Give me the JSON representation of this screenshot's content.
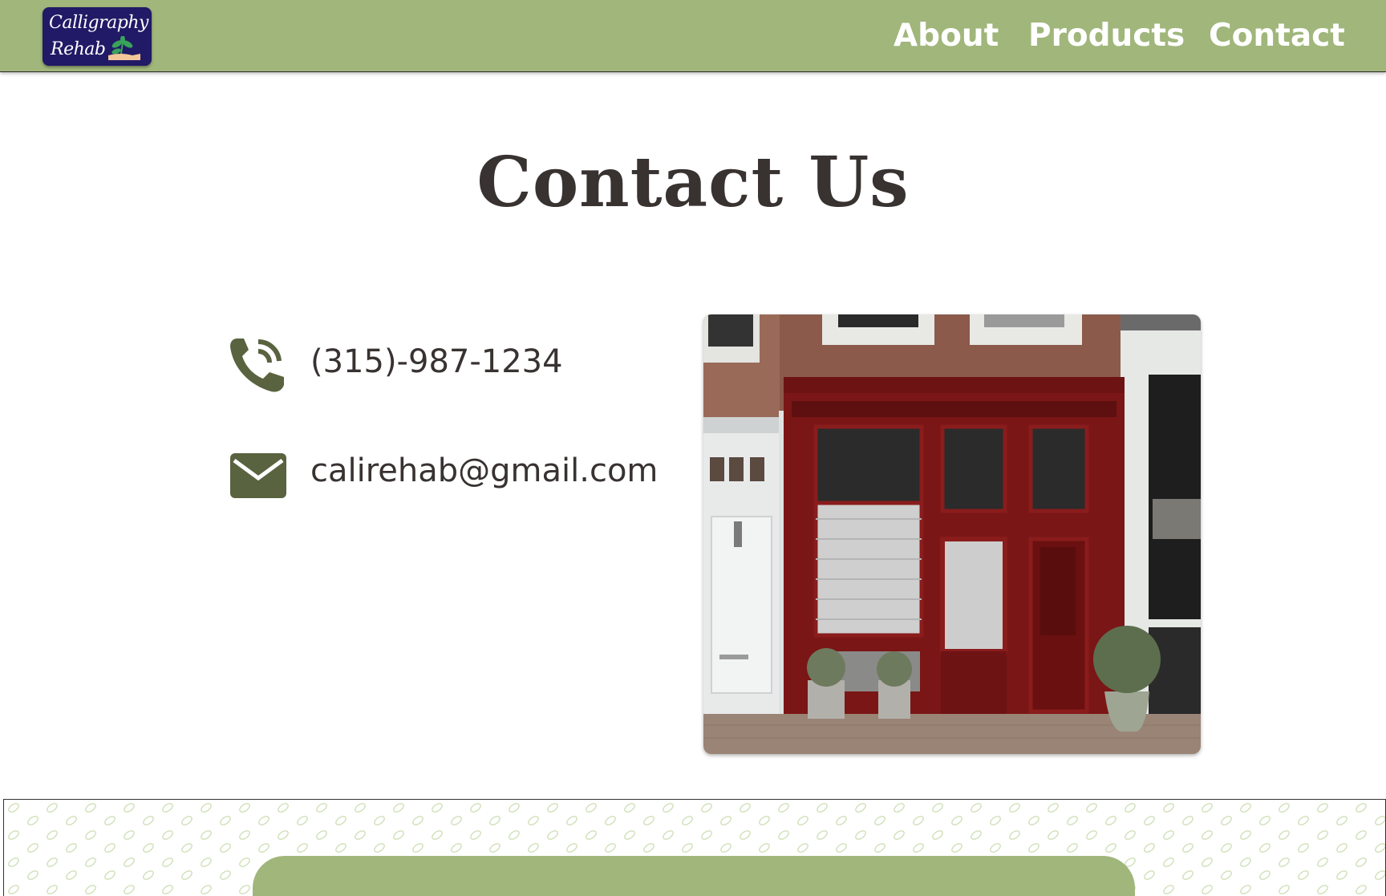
{
  "brand": {
    "logo_line1": "Calligraphy",
    "logo_line2": "Rehab",
    "logo_bg": "#211a66",
    "logo_icon": "sprout-in-hand-icon"
  },
  "nav": {
    "items": [
      {
        "label": "About"
      },
      {
        "label": "Products"
      },
      {
        "label": "Contact"
      }
    ],
    "bg": "#a0b67b"
  },
  "page": {
    "title": "Contact Us"
  },
  "contact": {
    "phone": {
      "icon": "phone-icon",
      "value": "(315)-987-1234"
    },
    "email": {
      "icon": "mail-icon",
      "value": "calirehab@gmail.com"
    },
    "icon_color": "#59633f"
  },
  "image": {
    "subject": "storefront-photo"
  },
  "footer": {
    "pattern": "leaf-pattern",
    "panel_color": "#a0b67b"
  }
}
